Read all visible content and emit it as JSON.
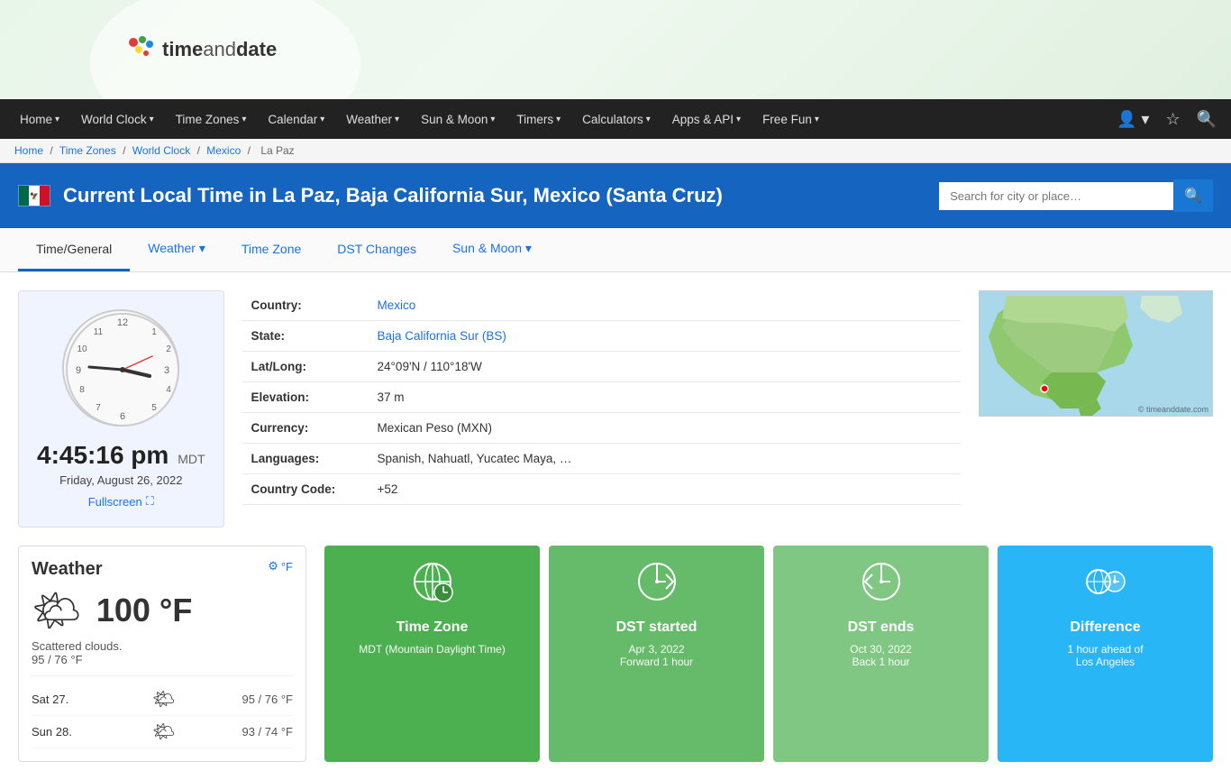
{
  "logo": {
    "text1": "time",
    "text2": "and",
    "text3": "date"
  },
  "nav": {
    "items": [
      {
        "label": "Home",
        "caret": true
      },
      {
        "label": "World Clock",
        "caret": true
      },
      {
        "label": "Time Zones",
        "caret": true
      },
      {
        "label": "Calendar",
        "caret": true
      },
      {
        "label": "Weather",
        "caret": true
      },
      {
        "label": "Sun & Moon",
        "caret": true
      },
      {
        "label": "Timers",
        "caret": true
      },
      {
        "label": "Calculators",
        "caret": true
      },
      {
        "label": "Apps & API",
        "caret": true
      },
      {
        "label": "Free Fun",
        "caret": true
      }
    ]
  },
  "breadcrumb": {
    "items": [
      "Home",
      "Time Zones",
      "World Clock",
      "Mexico",
      "La Paz"
    ]
  },
  "page": {
    "title": "Current Local Time in La Paz, Baja California Sur, Mexico (Santa Cruz)",
    "search_placeholder": "Search for city or place…"
  },
  "sub_tabs": [
    {
      "label": "Time/General",
      "active": true
    },
    {
      "label": "Weather",
      "caret": true
    },
    {
      "label": "Time Zone"
    },
    {
      "label": "DST Changes"
    },
    {
      "label": "Sun & Moon",
      "caret": true
    }
  ],
  "clock": {
    "time": "4:45:16 pm",
    "timezone": "MDT",
    "date": "Friday, August 26, 2022",
    "fullscreen": "Fullscreen"
  },
  "info": {
    "rows": [
      {
        "label": "Country:",
        "value": "Mexico",
        "link": true
      },
      {
        "label": "State:",
        "value": "Baja California Sur (BS)",
        "link": true
      },
      {
        "label": "Lat/Long:",
        "value": "24°09'N / 110°18'W"
      },
      {
        "label": "Elevation:",
        "value": "37 m"
      },
      {
        "label": "Currency:",
        "value": "Mexican Peso (MXN)"
      },
      {
        "label": "Languages:",
        "value": "Spanish, Nahuatl, Yucatec Maya, …"
      },
      {
        "label": "Country Code:",
        "value": "+52"
      }
    ]
  },
  "weather": {
    "title": "Weather",
    "temp": "100 °F",
    "unit_label": "°F",
    "description": "Scattered clouds.",
    "range": "95 / 76 °F",
    "forecast": [
      {
        "day": "Sat 27.",
        "icon": "🌤",
        "range": "95 / 76 °F"
      },
      {
        "day": "Sun 28.",
        "icon": "🌤",
        "range": "93 / 74 °F"
      }
    ]
  },
  "cards": [
    {
      "id": "timezone",
      "title": "Time Zone",
      "subtitle": "MDT (Mountain Daylight Time)",
      "color": "green1"
    },
    {
      "id": "dst-started",
      "title": "DST started",
      "subtitle": "Apr 3, 2022\nForward 1 hour",
      "subtitle1": "Apr 3, 2022",
      "subtitle2": "Forward 1 hour",
      "color": "green2"
    },
    {
      "id": "dst-ends",
      "title": "DST ends",
      "subtitle1": "Oct 30, 2022",
      "subtitle2": "Back 1 hour",
      "color": "green3"
    },
    {
      "id": "difference",
      "title": "Difference",
      "subtitle1": "1 hour ahead of",
      "subtitle2": "Los Angeles",
      "color": "blue"
    }
  ]
}
